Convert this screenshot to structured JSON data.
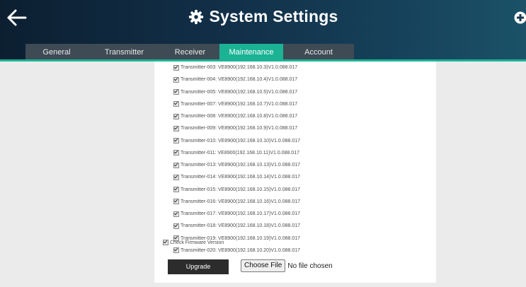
{
  "header": {
    "title": "System Settings",
    "back_icon": "arrow-left-icon",
    "settings_icon": "gear-icon",
    "add_icon": "plus-circle-icon"
  },
  "tabs": [
    {
      "label": "General",
      "active": false
    },
    {
      "label": "Transmitter",
      "active": false
    },
    {
      "label": "Receiver",
      "active": false
    },
    {
      "label": "Maintenance",
      "active": true
    },
    {
      "label": "Account",
      "active": false
    }
  ],
  "transmitters": [
    {
      "label": "Transmitter-003: VE8900(192.168.10.3)V1.0.088.017",
      "checked": true
    },
    {
      "label": "Transmitter-004: VE8900(192.168.10.4)V1.0.088.017",
      "checked": true
    },
    {
      "label": "Transmitter-005: VE8900(192.168.10.5)V1.0.088.017",
      "checked": true
    },
    {
      "label": "Transmitter-007: VE8900(192.168.10.7)V1.0.088.017",
      "checked": true
    },
    {
      "label": "Transmitter-008: VE8900(192.168.10.8)V1.0.088.017",
      "checked": true
    },
    {
      "label": "Transmitter-009: VE8900(192.168.10.9)V1.0.088.017",
      "checked": true
    },
    {
      "label": "Transmitter-010: VE8900(192.168.10.10)V1.0.088.017",
      "checked": true
    },
    {
      "label": "Transmitter-011: VE8900(192.168.10.11)V1.0.088.017",
      "checked": true
    },
    {
      "label": "Transmitter-013: VE8900(192.168.10.13)V1.0.088.017",
      "checked": true
    },
    {
      "label": "Transmitter-014: VE8900(192.168.10.14)V1.0.088.017",
      "checked": true
    },
    {
      "label": "Transmitter-015: VE8900(192.168.10.15)V1.0.088.017",
      "checked": true
    },
    {
      "label": "Transmitter-016: VE8900(192.168.10.16)V1.0.088.017",
      "checked": true
    },
    {
      "label": "Transmitter-017: VE8900(192.168.10.17)V1.0.088.017",
      "checked": true
    },
    {
      "label": "Transmitter-018: VE8900(192.168.10.18)V1.0.088.017",
      "checked": true
    },
    {
      "label": "Transmitter-019: VE8900(192.168.10.19)V1.0.088.017",
      "checked": true
    },
    {
      "label": "Transmitter-020: VE8900(192.168.10.20)V1.0.088.017",
      "checked": true
    }
  ],
  "firmware": {
    "label": "Check Firmware Version",
    "checked": true
  },
  "upgrade": {
    "label": "Upgrade"
  },
  "file": {
    "button_label": "Choose File",
    "status": "No file chosen"
  },
  "colors": {
    "accent": "#1cb394",
    "tab_bg": "#3e4a54",
    "header_dark": "#0c1f31",
    "header_light": "#1b5268",
    "button_dark": "#2c2c2c"
  }
}
